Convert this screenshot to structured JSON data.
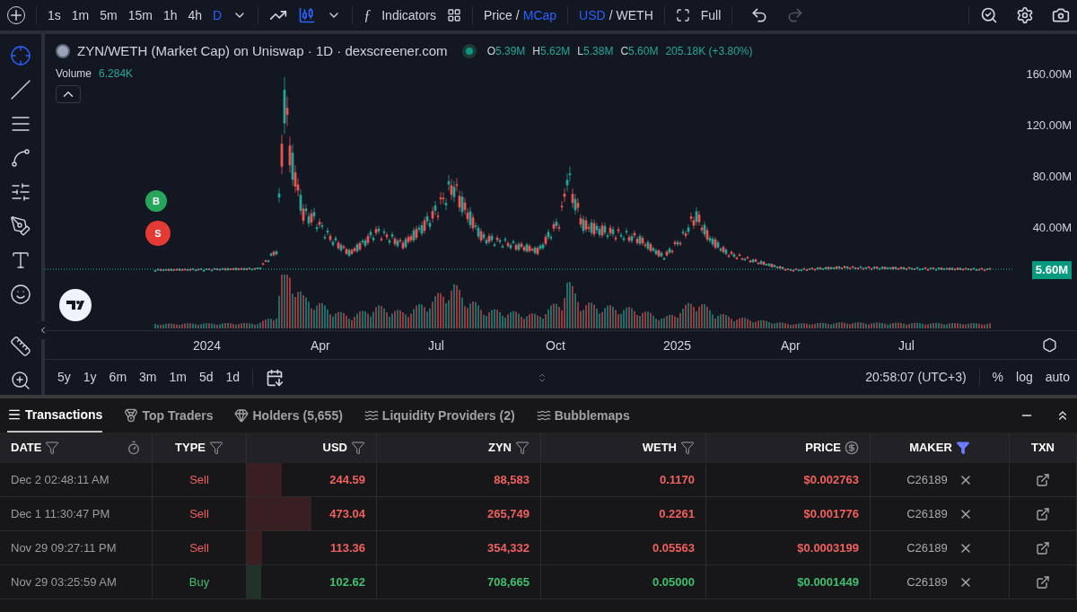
{
  "toolbar": {
    "timeframes": [
      {
        "label": "1s",
        "selected": false
      },
      {
        "label": "1m",
        "selected": false
      },
      {
        "label": "5m",
        "selected": false
      },
      {
        "label": "15m",
        "selected": false
      },
      {
        "label": "1h",
        "selected": false
      },
      {
        "label": "4h",
        "selected": false
      },
      {
        "label": "D",
        "selected": true
      }
    ],
    "function_glyph": "ƒ",
    "separator": "/",
    "indicators": "Indicators",
    "price_toggle": [
      {
        "label": "Price",
        "selected": false
      },
      {
        "label": "MCap",
        "selected": true
      }
    ],
    "currency_toggle": [
      {
        "label": "USD",
        "selected": true
      },
      {
        "label": "WETH",
        "selected": false
      }
    ],
    "full": "Full"
  },
  "tools": [
    {
      "kind": "crosshair",
      "selected": true
    },
    {
      "kind": "line",
      "selected": false
    },
    {
      "kind": "fib",
      "selected": false
    },
    {
      "kind": "pattern",
      "selected": false
    },
    {
      "kind": "forecast",
      "selected": false
    },
    {
      "kind": "brush",
      "selected": false
    },
    {
      "kind": "text",
      "selected": false
    },
    {
      "kind": "emoji",
      "selected": false
    },
    {
      "kind": "ruler",
      "selected": false
    },
    {
      "kind": "zoom",
      "selected": false
    }
  ],
  "legend": {
    "title": "ZYN/WETH (Market Cap) on Uniswap · 1D · dexscreener.com",
    "ohlc": [
      {
        "label": "O",
        "value": "5.39M"
      },
      {
        "label": "H",
        "value": "5.62M"
      },
      {
        "label": "L",
        "value": "5.38M"
      },
      {
        "label": "C",
        "value": "5.60M"
      }
    ],
    "change": "205.18K (+3.80%)",
    "volume_label": "Volume",
    "volume_value": "6.284K"
  },
  "markers": [
    {
      "label": "B",
      "kind": "buy"
    },
    {
      "label": "S",
      "kind": "sell"
    }
  ],
  "y_axis": [
    "160.00M",
    "120.00M",
    "80.00M",
    "40.00M"
  ],
  "last_price": "5.60M",
  "x_axis": [
    "2024",
    "Apr",
    "Jul",
    "Oct",
    "2025",
    "Apr",
    "Jul"
  ],
  "ranges": [
    "5y",
    "1y",
    "6m",
    "3m",
    "1m",
    "5d",
    "1d"
  ],
  "clock": "20:58:07 (UTC+3)",
  "scale_options": [
    "%",
    "log",
    "auto"
  ],
  "panel_tabs": [
    {
      "label": "Transactions",
      "selected": true
    },
    {
      "label": "Top Traders",
      "selected": false
    },
    {
      "label": "Holders (5,655)",
      "selected": false
    },
    {
      "label": "Liquidity Providers (2)",
      "selected": false
    },
    {
      "label": "Bubblemaps",
      "selected": false
    }
  ],
  "table": {
    "columns": [
      {
        "label": "DATE",
        "kind": "date"
      },
      {
        "label": "TYPE",
        "kind": "filter",
        "filtered": false
      },
      {
        "label": "USD",
        "kind": "filter",
        "filtered": false
      },
      {
        "label": "ZYN",
        "kind": "filter",
        "filtered": false
      },
      {
        "label": "WETH",
        "kind": "filter",
        "filtered": false
      },
      {
        "label": "PRICE",
        "kind": "price"
      },
      {
        "label": "MAKER",
        "kind": "filter",
        "filtered": true
      },
      {
        "label": "TXN",
        "kind": "plain"
      }
    ],
    "rows": [
      {
        "date": "Dec 2 02:48:11 AM",
        "kind": "sell",
        "type": "Sell",
        "usd": "244.59",
        "level": 0.27,
        "zyn": "88,583",
        "weth": "0.1170",
        "price": "$0.002763",
        "maker": "C26189"
      },
      {
        "date": "Dec 1 11:30:47 PM",
        "kind": "sell",
        "type": "Sell",
        "usd": "473.04",
        "level": 0.5,
        "zyn": "265,749",
        "weth": "0.2261",
        "price": "$0.001776",
        "maker": "C26189"
      },
      {
        "date": "Nov 29 09:27:11 PM",
        "kind": "sell",
        "type": "Sell",
        "usd": "113.36",
        "level": 0.12,
        "zyn": "354,332",
        "weth": "0.05563",
        "price": "$0.0003199",
        "maker": "C26189"
      },
      {
        "date": "Nov 29 03:25:59 AM",
        "kind": "buy",
        "type": "Buy",
        "usd": "102.62",
        "level": 0.11,
        "zyn": "708,665",
        "weth": "0.05000",
        "price": "$0.0001449",
        "maker": "C26189"
      }
    ]
  }
}
